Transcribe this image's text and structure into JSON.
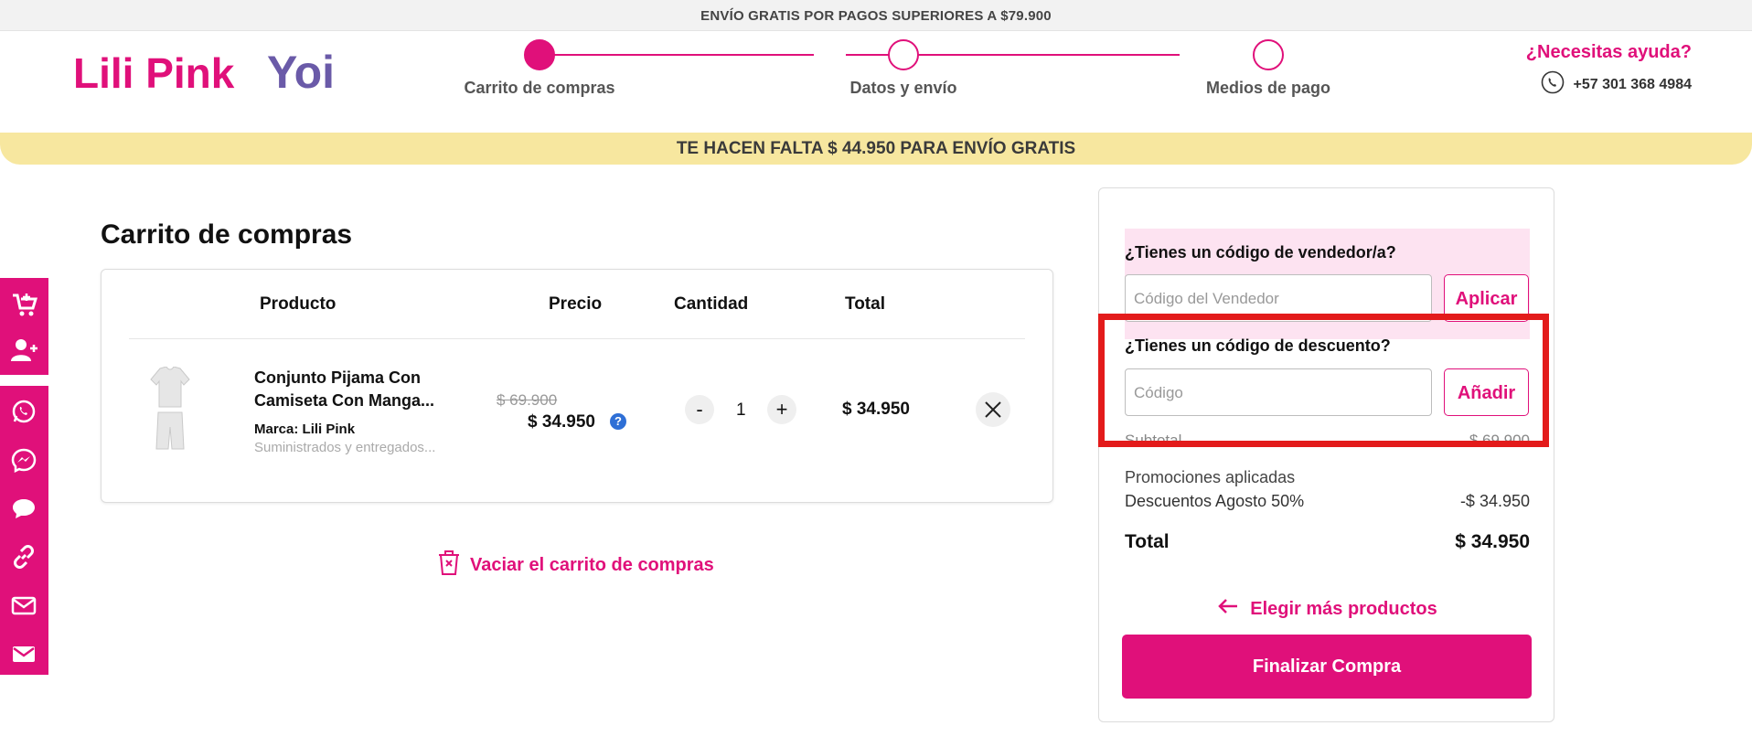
{
  "top_banner": "ENVÍO GRATIS POR PAGOS SUPERIORES A $79.900",
  "logo": {
    "brand_text": "Lili Pink",
    "sub_brand_text": "Yoi"
  },
  "steps": [
    {
      "label": "Carrito de compras",
      "active": true
    },
    {
      "label": "Datos y envío",
      "active": false
    },
    {
      "label": "Medios de pago",
      "active": false
    }
  ],
  "help": {
    "title": "¿Necesitas ayuda?",
    "phone": "+57 301 368 4984"
  },
  "free_shipping_bar": "TE HACEN FALTA $ 44.950 PARA ENVÍO GRATIS",
  "sidebar": {
    "icons": [
      "cart-plus-icon",
      "user-plus-icon",
      "whatsapp-icon",
      "messenger-icon",
      "chat-icon",
      "link-icon",
      "mail-icon",
      "envelope-icon"
    ]
  },
  "cart": {
    "title": "Carrito de compras",
    "headers": {
      "product": "Producto",
      "price": "Precio",
      "quantity": "Cantidad",
      "total": "Total"
    },
    "items": [
      {
        "name": "Conjunto Pijama Con Camiseta Con Manga...",
        "brand_label": "Marca:",
        "brand": "Lili Pink",
        "supply": "Suministrados y entregados...",
        "old_price": "$ 69.900",
        "price": "$ 34.950",
        "price_help": "?",
        "qty_minus": "-",
        "quantity": "1",
        "qty_plus": "+",
        "total": "$ 34.950"
      }
    ],
    "empty_cart": "Vaciar el carrito de compras"
  },
  "summary": {
    "vendor": {
      "label": "¿Tienes un código de vendedor/a?",
      "placeholder": "Código del Vendedor",
      "button": "Aplicar"
    },
    "discount": {
      "label": "¿Tienes un código de descuento?",
      "placeholder": "Código",
      "button": "Añadir"
    },
    "subtotal_label": "Subtotal",
    "subtotal_value": "$ 69.900",
    "promotions_label": "Promociones aplicadas",
    "promotion_name": "Descuentos Agosto 50%",
    "promotion_value": "-$ 34.950",
    "total_label": "Total",
    "total_value": "$ 34.950",
    "more_products": "Elegir más productos",
    "finish": "Finalizar Compra"
  },
  "colors": {
    "brand": "#e0107a",
    "highlight": "#e31b1b",
    "free_bar": "#f7e79f",
    "vendor_box": "#fde3f1"
  }
}
